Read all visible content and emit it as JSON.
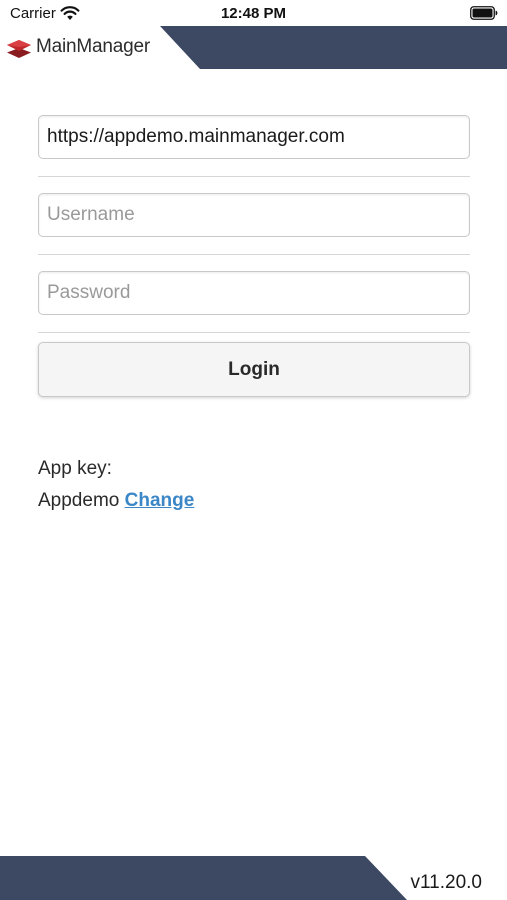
{
  "status_bar": {
    "carrier": "Carrier",
    "time": "12:48 PM",
    "wifi_icon": "wifi-icon",
    "battery_icon": "battery-icon"
  },
  "header": {
    "logo_text": "MainManager",
    "logo_icon": "layered-diamond-logo",
    "band_color": "#3d4963"
  },
  "form": {
    "server_url": {
      "value": "https://appdemo.mainmanager.com",
      "placeholder": ""
    },
    "username": {
      "value": "",
      "placeholder": "Username"
    },
    "password": {
      "value": "",
      "placeholder": "Password"
    },
    "login_label": "Login"
  },
  "app_key": {
    "label": "App key:",
    "value": "Appdemo",
    "change_label": "Change",
    "link_color": "#3a86c6"
  },
  "footer": {
    "version": "v11.20.0",
    "band_color": "#3d4963"
  },
  "colors": {
    "brand_red": "#c0282c",
    "navy": "#3d4963"
  }
}
